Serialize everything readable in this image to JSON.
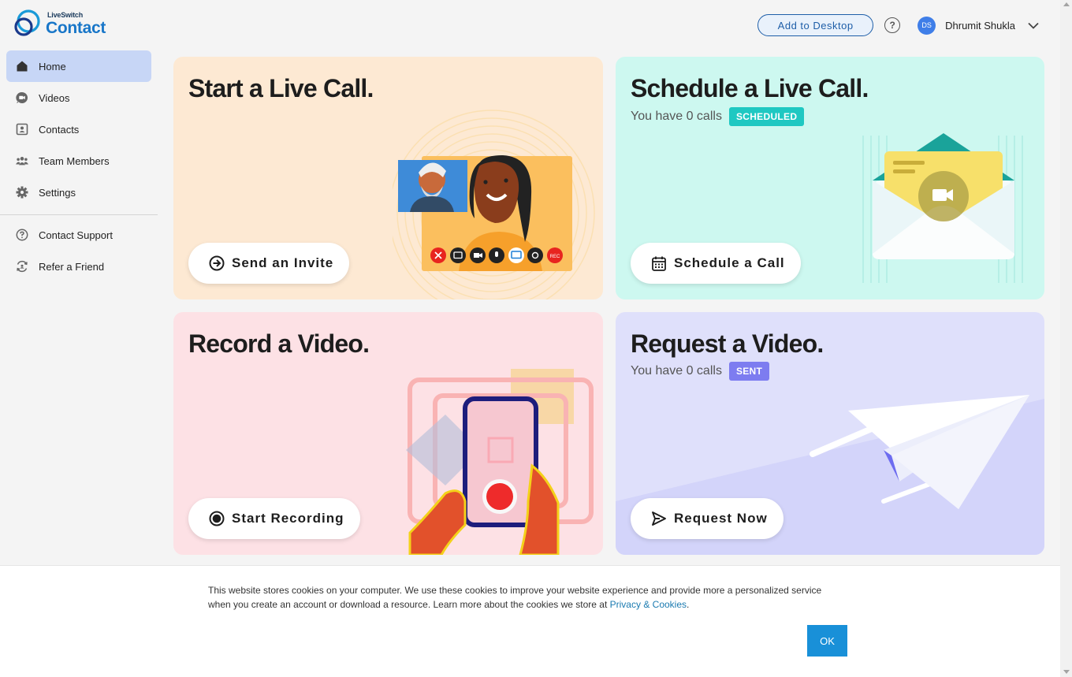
{
  "app": {
    "logo_small": "LiveSwitch",
    "logo_big": "Contact"
  },
  "header": {
    "add_to_desktop": "Add to Desktop",
    "help_icon": "question-circle-icon",
    "avatar_initials": "DS",
    "user_name": "Dhrumit Shukla",
    "chevron_icon": "chevron-down-icon"
  },
  "sidebar": {
    "items": [
      {
        "label": "Home",
        "icon": "home-icon",
        "active": true
      },
      {
        "label": "Videos",
        "icon": "video-chat-icon"
      },
      {
        "label": "Contacts",
        "icon": "contacts-icon"
      },
      {
        "label": "Team Members",
        "icon": "team-icon"
      },
      {
        "label": "Settings",
        "icon": "gear-icon"
      }
    ],
    "secondary": [
      {
        "label": "Contact Support",
        "icon": "question-circle-icon"
      },
      {
        "label": "Refer a Friend",
        "icon": "refer-icon"
      }
    ]
  },
  "cards": {
    "live_call": {
      "title": "Start a Live Call.",
      "button": "Send an Invite",
      "button_icon": "arrow-circle-right-icon",
      "rec_label": "REC"
    },
    "schedule": {
      "title": "Schedule a Live Call.",
      "sub_text": "You have 0 calls",
      "badge": "SCHEDULED",
      "button": "Schedule a Call",
      "button_icon": "calendar-icon"
    },
    "record": {
      "title": "Record a Video.",
      "button": "Start Recording",
      "button_icon": "record-icon"
    },
    "request": {
      "title": "Request a Video.",
      "sub_text": "You have 0 calls",
      "badge": "SENT",
      "button": "Request Now",
      "button_icon": "send-icon"
    }
  },
  "cookie": {
    "text": "This website stores cookies on your computer. We use these cookies to improve your website experience and provide more a personalized service when you create an account or download a resource. Learn more about the cookies we store at ",
    "link": "Privacy & Cookies",
    "period": ".",
    "ok": "OK"
  },
  "colors": {
    "accent": "#1e5ea8",
    "active_nav": "#c7d6f6",
    "card_live": "#fde9d3",
    "card_schedule": "#cdf8f0",
    "card_record": "#fde1e5",
    "card_request": "#dfe0fb",
    "badge_scheduled": "#1fc8c2",
    "badge_sent": "#7d7cf0"
  }
}
